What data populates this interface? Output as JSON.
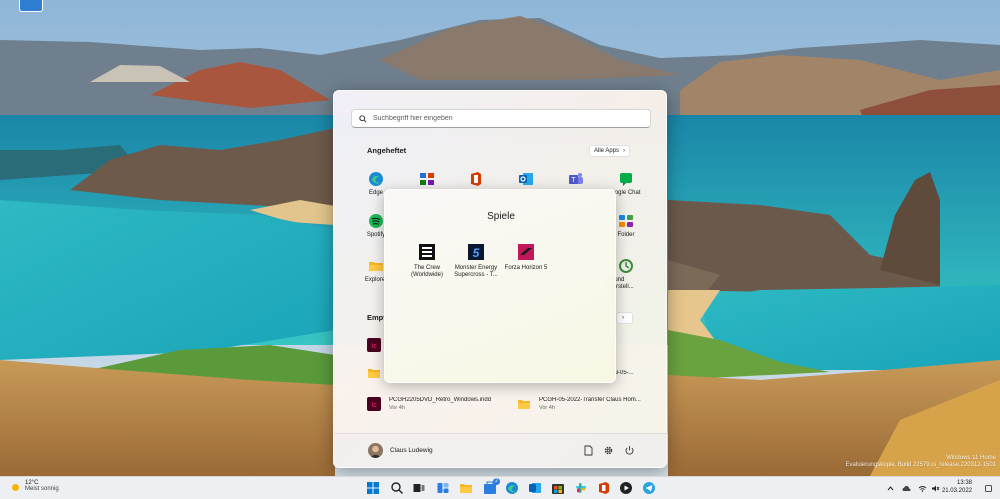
{
  "start_menu": {
    "search_placeholder": "Suchbegriff hier eingeben",
    "pinned_title": "Angeheftet",
    "all_apps_label": "Alle Apps",
    "pinned_apps": [
      {
        "label": "Edge",
        "icon": "edge-icon"
      },
      {
        "label": "",
        "icon": "folder-group-icon"
      },
      {
        "label": "",
        "icon": "office-icon"
      },
      {
        "label": "",
        "icon": "outlook-icon"
      },
      {
        "label": "",
        "icon": "teams-icon"
      },
      {
        "label": "oogle Chat",
        "icon": "google-chat-icon"
      },
      {
        "label": "Spotify",
        "icon": "spotify-icon"
      },
      {
        "label": "Folder",
        "icon": "app-folder-icon"
      },
      {
        "label": "Explorer",
        "icon": "file-explorer-icon"
      },
      {
        "label": "ern und\nerherstell...",
        "icon": "backup-restore-icon"
      }
    ],
    "recommended_title": "Empf",
    "recommended": [
      {
        "name": "PCGH2205DVD_Retro_Windows.indd",
        "time": "Vor 4h",
        "icon": "indesign-icon"
      },
      {
        "name": "PCGH-05-2022-Transfer Claus Hom...",
        "time": "Vor 4h",
        "icon": "folder-icon"
      },
      {
        "name": "",
        "time": "",
        "icon": "indesign-icon"
      },
      {
        "name": "",
        "time": "",
        "icon": "folder-icon"
      },
      {
        "name": "cial-05-...",
        "time": "",
        "icon": "folder-icon"
      }
    ],
    "user_name": "Claus Ludewig"
  },
  "folder_popup": {
    "title": "Spiele",
    "games": [
      {
        "label": "The Crew\n(Worldwide)",
        "icon": "the-crew-icon"
      },
      {
        "label": "Monster Energy\nSupercross - T...",
        "icon": "supercross-icon"
      },
      {
        "label": "Forza Horizon 5",
        "icon": "forza-horizon-icon"
      }
    ]
  },
  "taskbar": {
    "weather_temp": "12°C",
    "weather_desc": "Meist sonnig",
    "time": "13:38",
    "date": "21.03.2022",
    "notification_badge": "2",
    "icons": [
      "windows-start-icon",
      "search-icon",
      "task-view-icon",
      "widgets-icon",
      "file-explorer-icon",
      "store-icon",
      "edge-icon",
      "outlook-icon",
      "store-bag-icon",
      "slack-icon",
      "office-icon",
      "media-icon",
      "telegram-icon"
    ]
  },
  "watermark": {
    "line1": "Windows 11 Home",
    "line2": "Evaluierungskopie. Build 22579.ni_release.220312-1501"
  },
  "colors": {
    "accent": "#2b7de0",
    "edge": "#1b8ad6",
    "office": "#d83b01",
    "teams": "#5059c9",
    "spotify": "#1db954",
    "indesign": "#49021f",
    "forza": "#c2185b"
  }
}
